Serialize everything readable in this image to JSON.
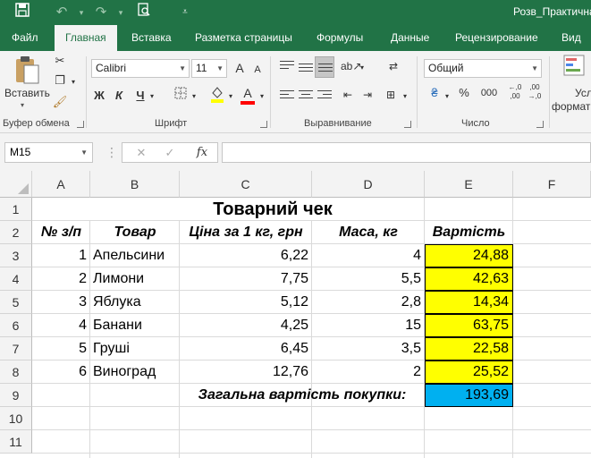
{
  "title_bar": {
    "doc_title": "Розв_Практична",
    "icons": [
      "save-icon",
      "undo-icon",
      "redo-icon",
      "print-preview-icon",
      "customize-quick-access-icon"
    ]
  },
  "tabs": [
    "Файл",
    "Главная",
    "Вставка",
    "Разметка страницы",
    "Формулы",
    "Данные",
    "Рецензирование",
    "Вид"
  ],
  "active_tab": "Главная",
  "ribbon": {
    "clipboard": {
      "paste_label": "Вставить",
      "group_label": "Буфер обмена"
    },
    "font": {
      "font_name": "Calibri",
      "font_size": "11",
      "bold": "Ж",
      "italic": "К",
      "underline": "Ч",
      "grow": "A",
      "shrink": "A",
      "color_letter": "A",
      "group_label": "Шрифт"
    },
    "alignment": {
      "group_label": "Выравнивание"
    },
    "number": {
      "format": "Общий",
      "group_label": "Число",
      "currency": "₴",
      "percent": "%",
      "thousands": "000",
      "inc_dec": "←,0\n,00",
      "dec_dec": ",00\n→,0"
    },
    "styles": {
      "line1": "Усл",
      "line2": "формат"
    },
    "colors": {
      "highlight": "#ffff00",
      "font_color": "#ff0000"
    }
  },
  "formula_bar": {
    "name_box": "M15",
    "fx": "fx",
    "formula": ""
  },
  "grid": {
    "columns": [
      "A",
      "B",
      "C",
      "D",
      "E",
      "F"
    ],
    "rows": [
      "1",
      "2",
      "3",
      "4",
      "5",
      "6",
      "7",
      "8",
      "9",
      "10",
      "11"
    ],
    "title": "Товарний чек",
    "headers": {
      "num": "№ з/п",
      "item": "Товар",
      "price": "Ціна за 1 кг, грн",
      "mass": "Маса, кг",
      "cost": "Вартість"
    },
    "items": [
      {
        "num": "1",
        "name": "Апельсини",
        "price": "6,22",
        "mass": "4",
        "cost": "24,88"
      },
      {
        "num": "2",
        "name": "Лимони",
        "price": "7,75",
        "mass": "5,5",
        "cost": "42,63"
      },
      {
        "num": "3",
        "name": "Яблука",
        "price": "5,12",
        "mass": "2,8",
        "cost": "14,34"
      },
      {
        "num": "4",
        "name": "Банани",
        "price": "4,25",
        "mass": "15",
        "cost": "63,75"
      },
      {
        "num": "5",
        "name": "Груші",
        "price": "6,45",
        "mass": "3,5",
        "cost": "22,58"
      },
      {
        "num": "6",
        "name": "Виноград",
        "price": "12,76",
        "mass": "2",
        "cost": "25,52"
      }
    ],
    "total_label": "Загальна вартість покупки:",
    "total_value": "193,69",
    "colors": {
      "cost_fill": "#ffff00",
      "total_fill": "#00b0f0"
    }
  }
}
